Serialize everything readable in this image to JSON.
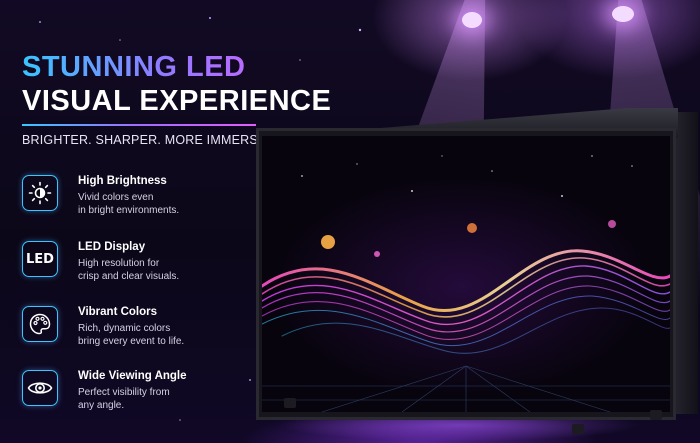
{
  "headline": {
    "line1": "STUNNING LED",
    "line2": "VISUAL EXPERIENCE"
  },
  "tagline": "BRIGHTER. SHARPER. MORE IMMERSIVE.",
  "features": [
    {
      "icon": "brightness-icon",
      "title": "High Brightness",
      "desc_line1": "Vivid colors even",
      "desc_line2": "in bright environments."
    },
    {
      "icon": "led-icon",
      "icon_text": "LED",
      "title": "LED Display",
      "desc_line1": "High resolution for",
      "desc_line2": "crisp and clear visuals."
    },
    {
      "icon": "palette-icon",
      "title": "Vibrant Colors",
      "desc_line1": "Rich, dynamic colors",
      "desc_line2": "bring every event to life."
    },
    {
      "icon": "eye-icon",
      "title": "Wide Viewing Angle",
      "desc_line1": "Perfect visibility from",
      "desc_line2": "any angle."
    }
  ],
  "colors": {
    "accent_cyan": "#37c6ff",
    "accent_magenta": "#e35cff",
    "background": "#0b0718"
  }
}
